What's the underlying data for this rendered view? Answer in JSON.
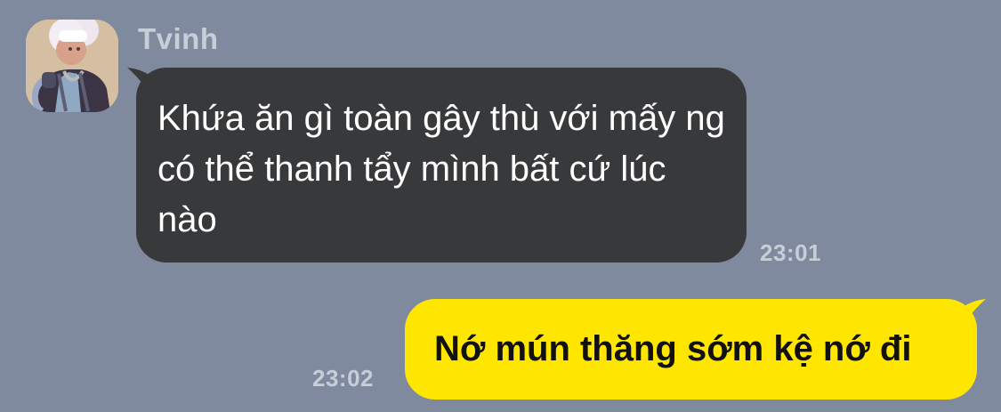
{
  "theme": {
    "background_color": "#7f8a9f",
    "incoming_bubble_color": "#38393b",
    "outgoing_bubble_color": "#ffe600"
  },
  "incoming_message": {
    "sender_name": "Tvinh",
    "text": "Khứa ăn gì toàn gây thù với mấy ng có thể thanh tẩy mình bất cứ lúc nào",
    "time": "23:01",
    "avatar_icon": "person-portrait-icon"
  },
  "outgoing_message": {
    "text": "Nớ mún thăng sớm kệ nớ đi",
    "time": "23:02"
  }
}
